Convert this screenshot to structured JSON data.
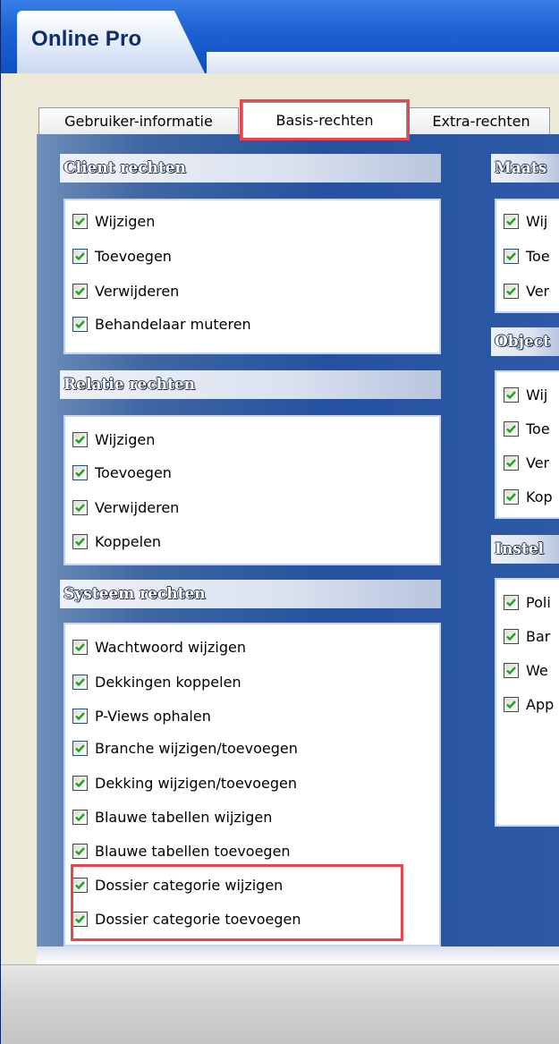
{
  "window": {
    "title": "Online Pro"
  },
  "tabs": [
    {
      "label": "Gebruiker-informatie",
      "active": false
    },
    {
      "label": "Basis-rechten",
      "active": true
    },
    {
      "label": "Extra-rechten",
      "active": false
    }
  ],
  "highlight_color": "#e8454d",
  "groups": {
    "client": {
      "title": "Client rechten",
      "items": [
        {
          "label": "Wijzigen",
          "checked": true
        },
        {
          "label": "Toevoegen",
          "checked": true
        },
        {
          "label": "Verwijderen",
          "checked": true
        },
        {
          "label": "Behandelaar muteren",
          "checked": true
        }
      ]
    },
    "relatie": {
      "title": "Relatie rechten",
      "items": [
        {
          "label": "Wijzigen",
          "checked": true
        },
        {
          "label": "Toevoegen",
          "checked": true
        },
        {
          "label": "Verwijderen",
          "checked": true
        },
        {
          "label": "Koppelen",
          "checked": true
        }
      ]
    },
    "systeem": {
      "title": "Systeem rechten",
      "items": [
        {
          "label": "Wachtwoord wijzigen",
          "checked": true
        },
        {
          "label": "Dekkingen koppelen",
          "checked": true
        },
        {
          "label": "P-Views ophalen",
          "checked": true
        },
        {
          "label": "Branche wijzigen/toevoegen",
          "checked": true
        },
        {
          "label": "Dekking wijzigen/toevoegen",
          "checked": true
        },
        {
          "label": "Blauwe tabellen wijzigen",
          "checked": true
        },
        {
          "label": "Blauwe tabellen toevoegen",
          "checked": true
        },
        {
          "label": "Dossier categorie wijzigen",
          "checked": true
        },
        {
          "label": "Dossier categorie toevoegen",
          "checked": true
        }
      ]
    },
    "maats": {
      "title": "Maats",
      "items": [
        {
          "label": "Wij",
          "checked": true
        },
        {
          "label": "Toe",
          "checked": true
        },
        {
          "label": "Ver",
          "checked": true
        }
      ]
    },
    "object": {
      "title": "Object",
      "items": [
        {
          "label": "Wij",
          "checked": true
        },
        {
          "label": "Toe",
          "checked": true
        },
        {
          "label": "Ver",
          "checked": true
        },
        {
          "label": "Kop",
          "checked": true
        }
      ]
    },
    "instel": {
      "title": "Instel",
      "items": [
        {
          "label": "Poli",
          "checked": true
        },
        {
          "label": "Bar",
          "checked": true
        },
        {
          "label": "We",
          "checked": true
        },
        {
          "label": "App",
          "checked": true
        }
      ]
    }
  }
}
